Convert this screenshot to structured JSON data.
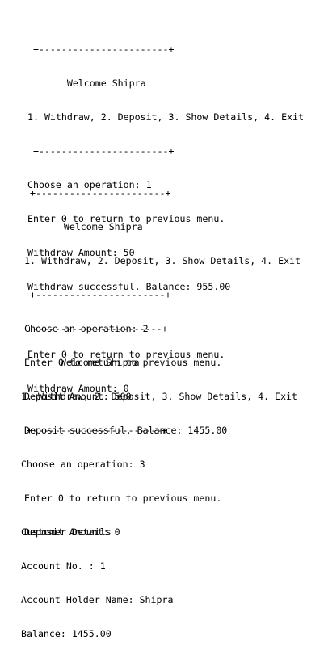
{
  "console": {
    "blocks": [
      {
        "lines": [
          " +-----------------------+",
          "       Welcome Shipra",
          "1. Withdraw, 2. Deposit, 3. Show Details, 4. Exit",
          " +-----------------------+",
          "Choose an operation: 1",
          "Enter 0 to return to previous menu.",
          "Withdraw Amount: 50",
          "Withdraw successful. Balance: 955.00",
          "",
          "Enter 0 to return to previous menu.",
          "Withdraw Amount: 0"
        ]
      },
      {
        "lines": [
          " +-----------------------+",
          "       Welcome Shipra",
          "1. Withdraw, 2. Deposit, 3. Show Details, 4. Exit",
          " +-----------------------+",
          "Choose an operation: 2",
          "Enter 0 to return to previous menu.",
          "Deposit Amount: 500",
          "Deposit successful. Balance: 1455.00",
          "",
          "Enter 0 to return to previous menu.",
          "Deposit Amount: 0"
        ]
      },
      {
        "lines": [
          " +-----------------------+",
          "       Welcome Shipra",
          "1. Withdraw, 2. Deposit, 3. Show Details, 4. Exit",
          " +-----------------------+",
          "Choose an operation: 3",
          "",
          "Customer Details",
          "Account No. : 1",
          "Account Holder Name: Shipra",
          "Balance: 1455.00"
        ]
      }
    ]
  }
}
